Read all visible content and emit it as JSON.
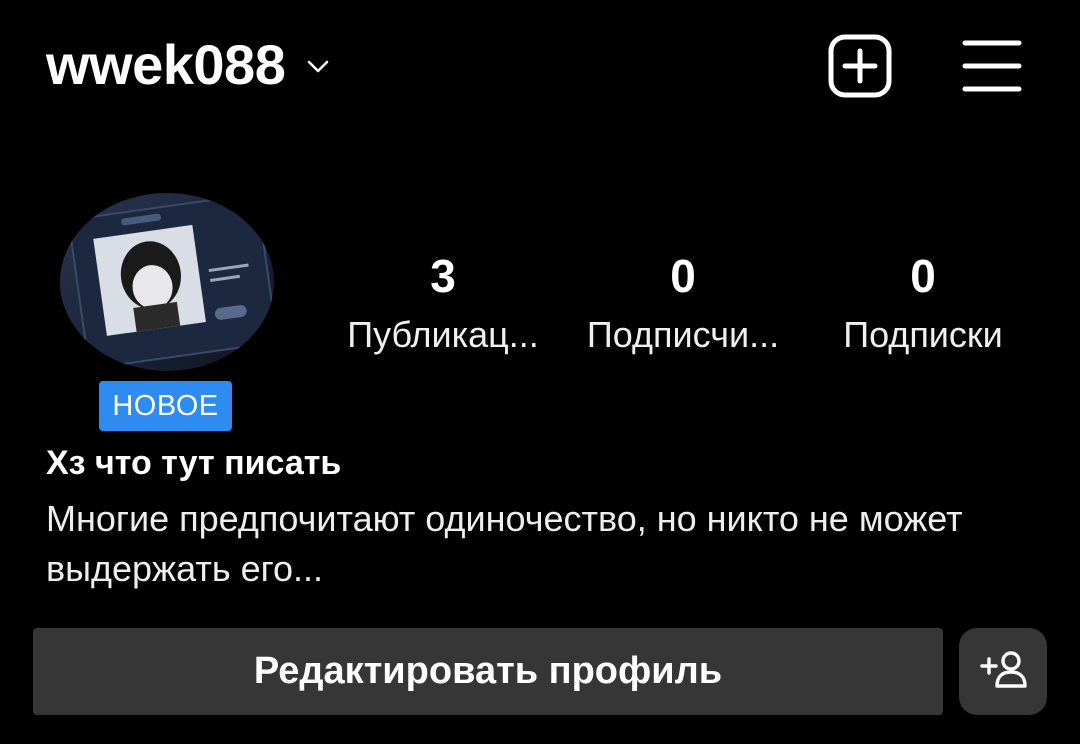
{
  "header": {
    "username": "wwek088",
    "icons": {
      "account_switch": "chevron-down-icon",
      "create": "plus-square-icon",
      "menu": "hamburger-menu-icon"
    }
  },
  "profile": {
    "avatar_icon": "avatar",
    "badge": "НОВОЕ",
    "stats": [
      {
        "value": "3",
        "label": "Публикац..."
      },
      {
        "value": "0",
        "label": "Подписчи..."
      },
      {
        "value": "0",
        "label": "Подписки"
      }
    ]
  },
  "bio": {
    "name": "Хз что тут писать",
    "text": "Многие предпочитают одиночество, но никто не может выдержать его..."
  },
  "actions": {
    "edit_profile": "Редактировать профиль",
    "discover_people_icon": "add-person-icon"
  },
  "colors": {
    "background": "#000000",
    "button": "#363636",
    "badge": "#2e8bf0",
    "text": "#ffffff"
  }
}
